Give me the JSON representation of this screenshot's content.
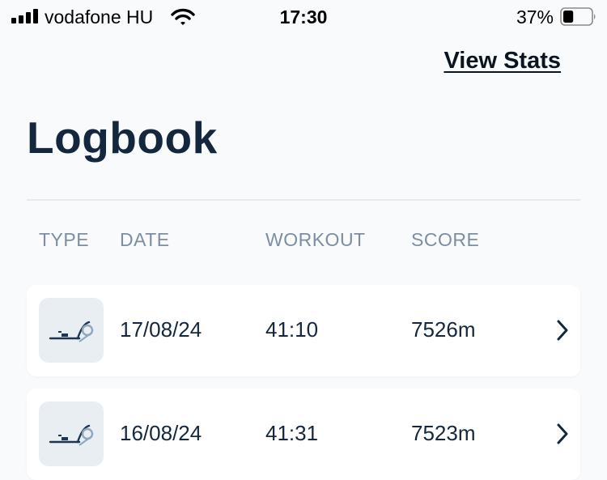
{
  "status_bar": {
    "carrier": "vodafone HU",
    "time": "17:30",
    "battery_percent": "37%",
    "battery_level": 0.37,
    "signal_icon": "cellular-signal-icon",
    "wifi_icon": "wifi-icon",
    "battery_icon": "battery-icon"
  },
  "header": {
    "view_stats_label": "View Stats",
    "title": "Logbook"
  },
  "table": {
    "columns": [
      "TYPE",
      "DATE",
      "WORKOUT",
      "SCORE"
    ],
    "rows": [
      {
        "type_icon": "rowing-machine-icon",
        "date": "17/08/24",
        "workout": "41:10",
        "score": "7526m"
      },
      {
        "type_icon": "rowing-machine-icon",
        "date": "16/08/24",
        "workout": "41:31",
        "score": "7523m"
      }
    ]
  },
  "colors": {
    "background": "#f9fafc",
    "title": "#14273d",
    "header_text": "#7d8ea3",
    "icon_bg": "#e9eef3",
    "card": "#ffffff"
  }
}
